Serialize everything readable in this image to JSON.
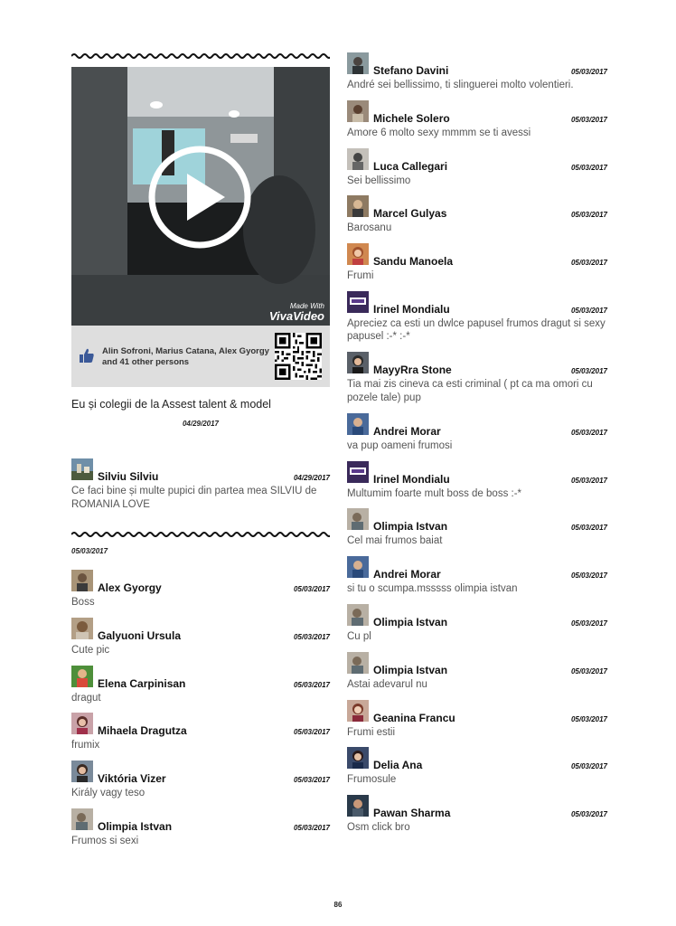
{
  "post": {
    "video_watermark_top": "Made With",
    "video_watermark_brand": "VivaVideo",
    "likes_text": "Alin Sofroni, Marius Catana, Alex Gyorgy and 41 other persons",
    "caption": "Eu și colegii de la Assest talent & model",
    "date": "04/29/2017"
  },
  "first_comment": {
    "name": "Silviu Silviu",
    "date": "04/29/2017",
    "text": "Ce faci bine și multe pupici din partea mea SILVIU de ROMANIA LOVE"
  },
  "section_date": "05/03/2017",
  "left_comments": [
    {
      "name": "Alex Gyorgy",
      "date": "05/03/2017",
      "text": "Boss"
    },
    {
      "name": "Galyuoni Ursula",
      "date": "05/03/2017",
      "text": "Cute pic"
    },
    {
      "name": "Elena Carpinisan",
      "date": "05/03/2017",
      "text": "dragut"
    },
    {
      "name": "Mihaela Dragutza",
      "date": "05/03/2017",
      "text": "frumix"
    },
    {
      "name": "Viktória Vizer",
      "date": "05/03/2017",
      "text": "Király vagy teso"
    },
    {
      "name": "Olimpia Istvan",
      "date": "05/03/2017",
      "text": "Frumos si sexi"
    }
  ],
  "right_comments": [
    {
      "name": "Stefano Davini",
      "date": "05/03/2017",
      "text": "André sei bellissimo, ti slinguerei molto volentieri."
    },
    {
      "name": "Michele Solero",
      "date": "05/03/2017",
      "text": "Amore 6 molto sexy mmmm se ti avessi"
    },
    {
      "name": "Luca Callegari",
      "date": "05/03/2017",
      "text": "Sei bellissimo"
    },
    {
      "name": "Marcel Gulyas",
      "date": "05/03/2017",
      "text": "Barosanu"
    },
    {
      "name": "Sandu Manoela",
      "date": "05/03/2017",
      "text": "Frumi"
    },
    {
      "name": "Irinel Mondialu",
      "date": "05/03/2017",
      "text": "Apreciez ca esti un dwlce papusel frumos dragut si sexy papusel :-* :-*"
    },
    {
      "name": "MayyRra Stone",
      "date": "05/03/2017",
      "text": "Tia mai zis cineva ca esti criminal ( pt ca ma omori cu pozele tale) pup"
    },
    {
      "name": "Andrei Morar",
      "date": "05/03/2017",
      "text": "va pup oameni frumosi"
    },
    {
      "name": "Irinel Mondialu",
      "date": "05/03/2017",
      "text": "Multumim foarte mult boss de boss :-*"
    },
    {
      "name": "Olimpia Istvan",
      "date": "05/03/2017",
      "text": "Cel mai frumos baiat"
    },
    {
      "name": "Andrei Morar",
      "date": "05/03/2017",
      "text": "si tu o scumpa.msssss olimpia istvan"
    },
    {
      "name": "Olimpia Istvan",
      "date": "05/03/2017",
      "text": "Cu pl"
    },
    {
      "name": "Olimpia Istvan",
      "date": "05/03/2017",
      "text": "Astai adevarul nu"
    },
    {
      "name": "Geanina Francu",
      "date": "05/03/2017",
      "text": "Frumi estii"
    },
    {
      "name": "Delia Ana",
      "date": "05/03/2017",
      "text": "Frumosule"
    },
    {
      "name": "Pawan Sharma",
      "date": "05/03/2017",
      "text": "Osm click bro"
    }
  ],
  "page_number": "86"
}
